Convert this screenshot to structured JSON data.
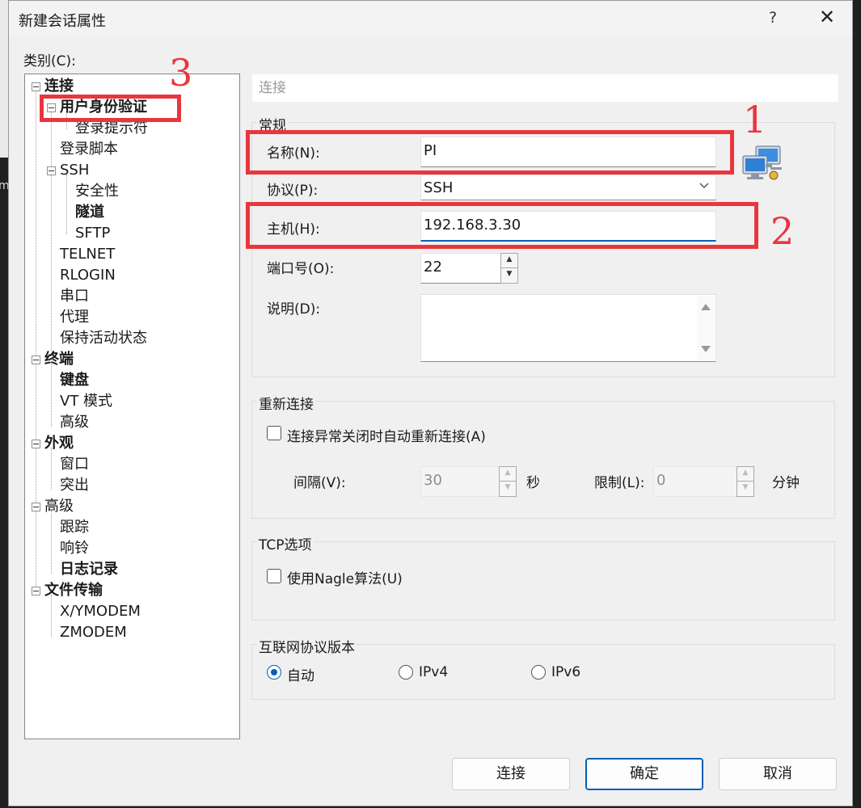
{
  "window": {
    "title": "新建会话属性",
    "help": "?",
    "close": "✕"
  },
  "sidebar": {
    "category_label": "类别(C):",
    "items": [
      {
        "label": "连接"
      },
      {
        "label": "用户身份验证"
      },
      {
        "label": "登录提示符"
      },
      {
        "label": "登录脚本"
      },
      {
        "label": "SSH"
      },
      {
        "label": "安全性"
      },
      {
        "label": "隧道"
      },
      {
        "label": "SFTP"
      },
      {
        "label": "TELNET"
      },
      {
        "label": "RLOGIN"
      },
      {
        "label": "串口"
      },
      {
        "label": "代理"
      },
      {
        "label": "保持活动状态"
      },
      {
        "label": "终端"
      },
      {
        "label": "键盘"
      },
      {
        "label": "VT 模式"
      },
      {
        "label": "高级"
      },
      {
        "label": "外观"
      },
      {
        "label": "窗口"
      },
      {
        "label": "突出"
      },
      {
        "label": "高级"
      },
      {
        "label": "跟踪"
      },
      {
        "label": "响铃"
      },
      {
        "label": "日志记录"
      },
      {
        "label": "文件传输"
      },
      {
        "label": "X/YMODEM"
      },
      {
        "label": "ZMODEM"
      }
    ]
  },
  "main": {
    "section_title": "连接",
    "general": {
      "title": "常规",
      "name_label": "名称(N):",
      "name_value": "PI",
      "protocol_label": "协议(P):",
      "protocol_value": "SSH",
      "host_label": "主机(H):",
      "host_value": "192.168.3.30",
      "port_label": "端口号(O):",
      "port_value": "22",
      "desc_label": "说明(D):",
      "desc_value": ""
    },
    "reconnect": {
      "title": "重新连接",
      "auto_label": "连接异常关闭时自动重新连接(A)",
      "auto_checked": false,
      "interval_label": "间隔(V):",
      "interval_value": "30",
      "interval_unit": "秒",
      "limit_label": "限制(L):",
      "limit_value": "0",
      "limit_unit": "分钟"
    },
    "tcp": {
      "title": "TCP选项",
      "nagle_label": "使用Nagle算法(U)",
      "nagle_checked": false
    },
    "ip": {
      "title": "互联网协议版本",
      "options": [
        "自动",
        "IPv4",
        "IPv6"
      ],
      "selected": "自动"
    }
  },
  "buttons": {
    "connect": "连接",
    "ok": "确定",
    "cancel": "取消"
  },
  "annotations": {
    "marks": [
      "1",
      "2",
      "3"
    ],
    "color": "#e8363f"
  },
  "edge_fragment": "m"
}
